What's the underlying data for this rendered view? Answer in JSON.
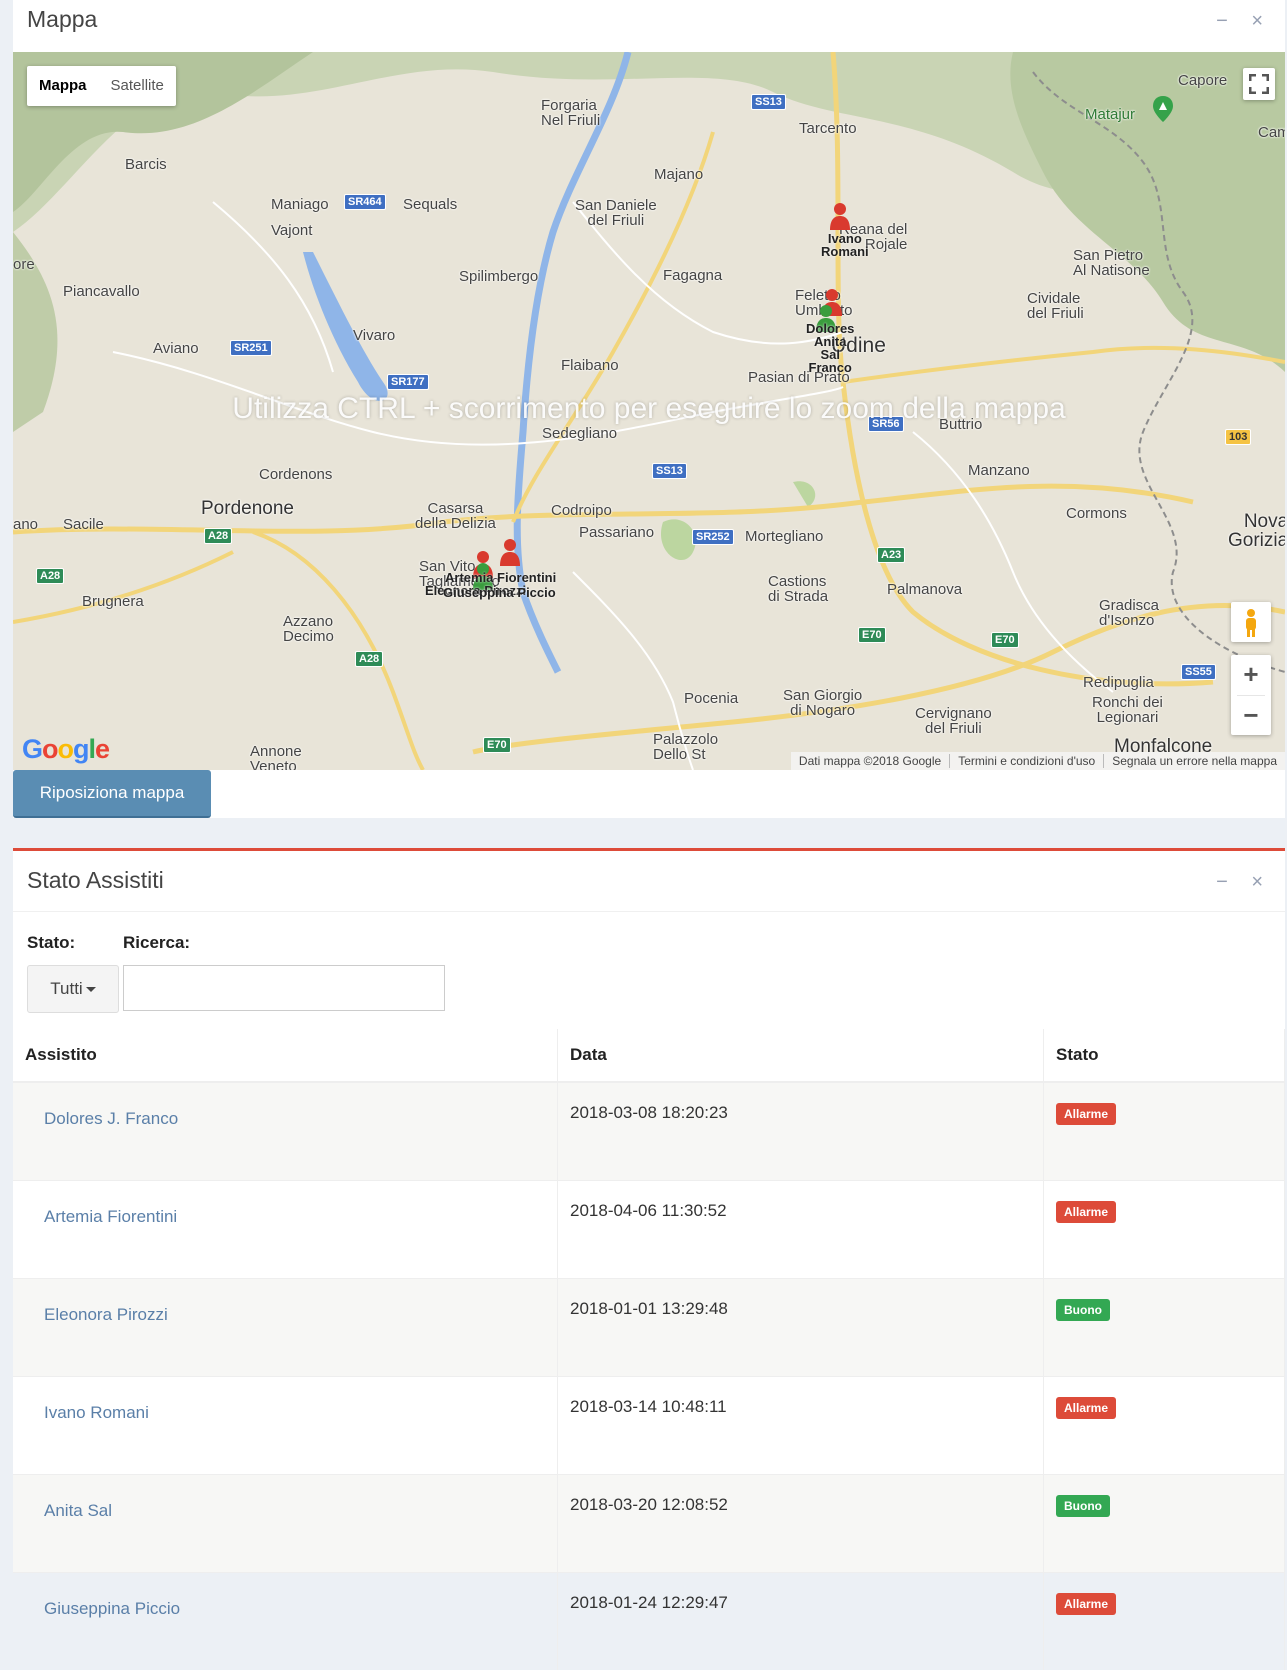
{
  "map_box": {
    "title": "Mappa",
    "minimize": "−",
    "close": "×",
    "map_type": {
      "active": "Mappa",
      "inactive": "Satellite"
    },
    "overlay_message": "Utilizza CTRL + scorrimento per eseguire lo zoom della mappa",
    "google_logo": "Google",
    "attribution": {
      "data": "Dati mappa ©2018 Google",
      "terms": "Termini e condizioni d'uso",
      "report": "Segnala un errore nella mappa"
    },
    "zoom_in": "+",
    "zoom_out": "−",
    "reposition_button": "Riposiziona mappa",
    "places": {
      "forgaria": "Forgaria\nNel Friuli",
      "tarcento": "Tarcento",
      "matajur": "Matajur",
      "capore": "Capore",
      "cami": "Cami",
      "barcis": "Barcis",
      "maniago": "Maniago",
      "sequals": "Sequals",
      "vajont": "Vajont",
      "san_daniele": "San Daniele\ndel Friuli",
      "majano": "Majano",
      "reana": "Reana del\nRojale",
      "san_pietro": "San Pietro\nAl Natisone",
      "piancavallo": "Piancavallo",
      "spilimbergo": "Spilimbergo",
      "fagagna": "Fagagna",
      "feletto": "Feletto\nUmberto",
      "cividale": "Cividale\ndel Friuli",
      "aviano": "Aviano",
      "vivaro": "Vivaro",
      "udine": "Udine",
      "flaibano": "Flaibano",
      "pasian": "Pasian di Prato",
      "sedegliano": "Sedegliano",
      "buttrio": "Buttrio",
      "cordenons": "Cordenons",
      "manzano": "Manzano",
      "pordenone": "Pordenone",
      "casarsa": "Casarsa\ndella Delizia",
      "codroipo": "Codroipo",
      "passariano": "Passariano",
      "mortegliano": "Mortegliano",
      "cormons": "Cormons",
      "nova_gorica": "Nova\nGorizia",
      "sacile": "Sacile",
      "castions": "Castions\ndi Strada",
      "palmanova": "Palmanova",
      "brugnera": "Brugnera",
      "azzano": "Azzano\nDecimo",
      "gradisca": "Gradisca\nd'Isonzo",
      "redipuglia": "Redipuglia",
      "ronchi": "Ronchi dei\nLegionari",
      "pocenia": "Pocenia",
      "san_giorgio": "San Giorgio\ndi Nogaro",
      "cervignano": "Cervignano\ndel Friuli",
      "monfalcone": "Monfalcone",
      "annone": "Annone\nVeneto",
      "palazzolo": "Palazzolo\nDello St",
      "ore": "ore",
      "ano": "ano",
      "san_vito": "San Vito\nTagliamento"
    },
    "roads": [
      "SS13",
      "SR464",
      "SR251",
      "SR177",
      "SS13",
      "SR56",
      "SR252",
      "A28",
      "A28",
      "A28",
      "A23",
      "E70",
      "E70",
      "E70",
      "SS55",
      "103"
    ],
    "marker_labels": {
      "ivano": "Ivano\nRomani",
      "dolores": "Dolores\nAnita\nSal\nFranco",
      "artemia": "Artemia Fiorentini",
      "eleonora": "Eleonora Pirozzi",
      "giuseppina": "Giuseppina Piccio"
    }
  },
  "status_box": {
    "title": "Stato Assistiti",
    "minimize": "−",
    "close": "×",
    "filter_label": "Stato:",
    "search_label": "Ricerca:",
    "filter_value": "Tutti",
    "search_value": "",
    "columns": [
      "Assistito",
      "Data",
      "Stato"
    ],
    "rows": [
      {
        "name": "Dolores J. Franco",
        "date": "2018-03-08 18:20:23",
        "state": "Allarme",
        "color": "#dd4b39"
      },
      {
        "name": "Artemia Fiorentini",
        "date": "2018-04-06 11:30:52",
        "state": "Allarme",
        "color": "#dd4b39"
      },
      {
        "name": "Eleonora Pirozzi",
        "date": "2018-01-01 13:29:48",
        "state": "Buono",
        "color": "#33a853"
      },
      {
        "name": "Ivano Romani",
        "date": "2018-03-14 10:48:11",
        "state": "Allarme",
        "color": "#dd4b39"
      },
      {
        "name": "Anita Sal",
        "date": "2018-03-20 12:08:52",
        "state": "Buono",
        "color": "#33a853"
      },
      {
        "name": "Giuseppina Piccio",
        "date": "2018-01-24 12:29:47",
        "state": "Allarme",
        "color": "#dd4b39"
      }
    ]
  },
  "colors": {
    "accent": "#dd4b39",
    "button": "#5a8db3",
    "link": "#5a7fa8"
  }
}
